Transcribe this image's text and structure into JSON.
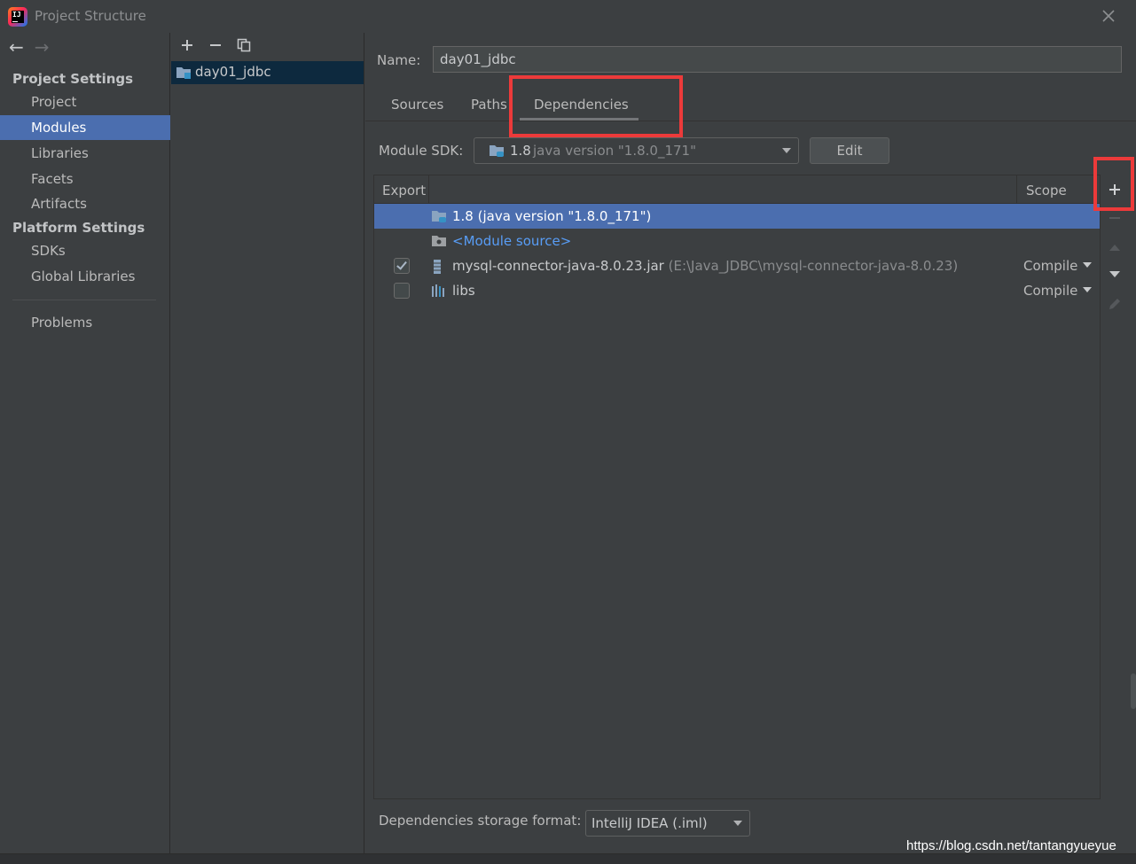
{
  "window": {
    "title": "Project Structure"
  },
  "nav": {
    "project_settings_heading": "Project Settings",
    "project_settings_items": [
      "Project",
      "Modules",
      "Libraries",
      "Facets",
      "Artifacts"
    ],
    "platform_settings_heading": "Platform Settings",
    "platform_settings_items": [
      "SDKs",
      "Global Libraries"
    ],
    "problems": "Problems",
    "selected": "Modules"
  },
  "modules": {
    "items": [
      "day01_jdbc"
    ]
  },
  "module": {
    "name_label": "Name:",
    "name_value": "day01_jdbc",
    "tabs": [
      "Sources",
      "Paths",
      "Dependencies"
    ],
    "active_tab": "Dependencies",
    "sdk_label": "Module SDK:",
    "sdk_version": "1.8",
    "sdk_detail": "java version \"1.8.0_171\"",
    "edit_button": "Edit"
  },
  "dependencies": {
    "columns": [
      "Export",
      "Scope"
    ],
    "rows": [
      {
        "name": "1.8 (java version \"1.8.0_171\")",
        "icon": "jdk-folder-icon",
        "selected": true
      },
      {
        "name": "<Module source>",
        "icon": "module-source-folder-icon"
      },
      {
        "name": "mysql-connector-java-8.0.23.jar",
        "path": "(E:\\Java_JDBC\\mysql-connector-java-8.0.23)",
        "icon": "jar-icon",
        "export": true,
        "scope": "Compile"
      },
      {
        "name": "libs",
        "icon": "library-icon",
        "export": false,
        "scope": "Compile"
      }
    ]
  },
  "storage": {
    "label": "Dependencies storage format:",
    "value": "IntelliJ IDEA (.iml)"
  },
  "watermark": "https://blog.csdn.net/tantangyueyue",
  "colors": {
    "selection": "#4b6eaf",
    "highlight": "#ec3a3a",
    "link": "#589df6",
    "background": "#3c3f41"
  }
}
